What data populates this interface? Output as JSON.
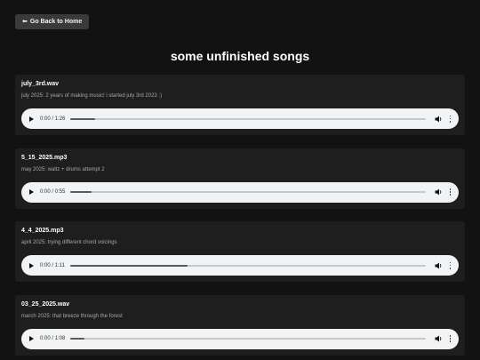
{
  "back_button": {
    "icon": "back-arrow-icon",
    "arrow_glyph": "⬅",
    "label": "Go Back to Home"
  },
  "page": {
    "title": "some unfinished songs"
  },
  "songs": [
    {
      "title": "july_3rd.wav",
      "description": "july 2025: 2 years of making music! i started july 3rd 2023 :)",
      "time": "0:00 / 1:26",
      "progress": 0.07
    },
    {
      "title": "5_15_2025.mp3",
      "description": "may 2025: waltz + drums attempt 2",
      "time": "0:00 / 0:55",
      "progress": 0.06
    },
    {
      "title": "4_4_2025.mp3",
      "description": "april 2025: trying different chord voicings",
      "time": "0:00 / 1:11",
      "progress": 0.33
    },
    {
      "title": "03_25_2025.wav",
      "description": "march 2025: that breeze through the forest",
      "time": "0:00 / 1:08",
      "progress": 0.04
    }
  ],
  "colors": {
    "background": "#121212",
    "card": "#1e1e1e",
    "button": "#3a3a3a",
    "player": "#f1f3f4"
  }
}
